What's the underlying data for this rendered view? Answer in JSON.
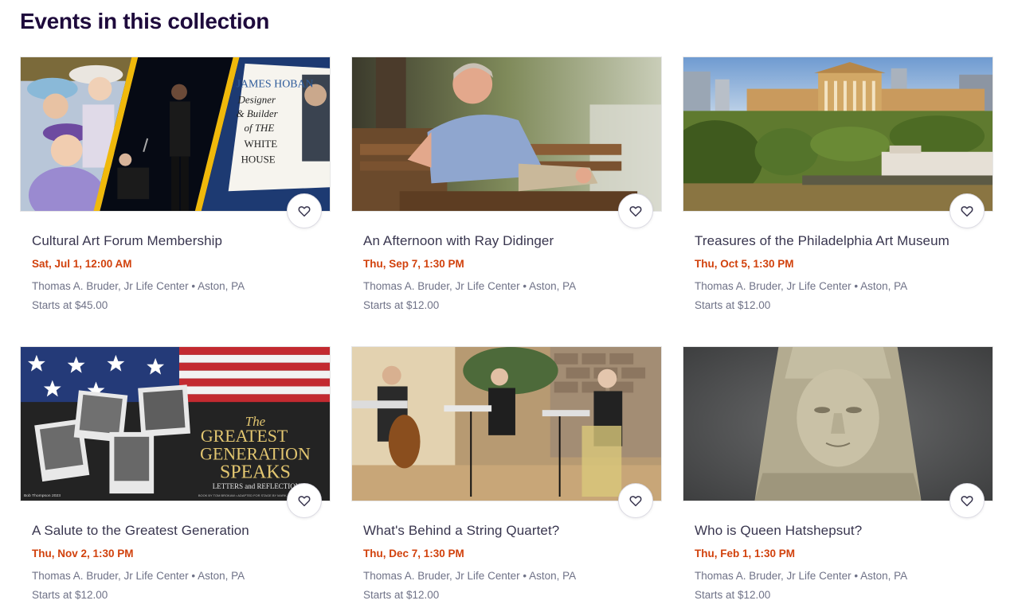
{
  "section": {
    "title": "Events in this collection"
  },
  "events": [
    {
      "title": "Cultural Art Forum Membership",
      "date": "Sat, Jul 1, 12:00 AM",
      "venue": "Thomas A. Bruder, Jr Life Center • Aston, PA",
      "price": "Starts at $45.00",
      "image_alt": "Collage: women in hats, a performer on stage, James Hoban book cover",
      "book_title_lines": [
        "JAMES HOBAN",
        "Designer",
        "& Builder",
        "of THE",
        "WHITE",
        "HOUSE"
      ]
    },
    {
      "title": "An Afternoon with Ray Didinger",
      "date": "Thu, Sep 7, 1:30 PM",
      "venue": "Thomas A. Bruder, Jr Life Center • Aston, PA",
      "price": "Starts at $12.00",
      "image_alt": "Smiling man sitting on a wooden bench"
    },
    {
      "title": "Treasures of the Philadelphia Art Museum",
      "date": "Thu, Oct 5, 1:30 PM",
      "venue": "Thomas A. Bruder, Jr Life Center • Aston, PA",
      "price": "Starts at $12.00",
      "image_alt": "Aerial view of the Philadelphia Museum of Art and the river"
    },
    {
      "title": "A Salute to the Greatest Generation",
      "date": "Thu, Nov 2, 1:30 PM",
      "venue": "Thomas A. Bruder, Jr Life Center • Aston, PA",
      "price": "Starts at $12.00",
      "image_alt": "American flag with vintage photos",
      "poster_lines": [
        "The",
        "GREATEST",
        "GENERATION",
        "SPEAKS",
        "LETTERS and REFLECTIONS"
      ],
      "poster_credit": "Bob Thompson 2023",
      "poster_footer": "BOOK BY TOM BROKAW • ADAPTED FOR STAGE BY MARK..."
    },
    {
      "title": "What's Behind a String Quartet?",
      "date": "Thu, Dec 7, 1:30 PM",
      "venue": "Thomas A. Bruder, Jr Life Center • Aston, PA",
      "price": "Starts at $12.00",
      "image_alt": "String quartet performing indoors"
    },
    {
      "title": "Who is Queen Hatshepsut?",
      "date": "Thu, Feb 1, 1:30 PM",
      "venue": "Thomas A. Bruder, Jr Life Center • Aston, PA",
      "price": "Starts at $12.00",
      "image_alt": "Stone sculpture head of Queen Hatshepsut"
    }
  ],
  "colors": {
    "title": "#1e0a3c",
    "date": "#d1410c",
    "meta": "#6f7287",
    "card_title": "#39364f"
  },
  "icons": {
    "favorite": "heart-outline-icon"
  }
}
